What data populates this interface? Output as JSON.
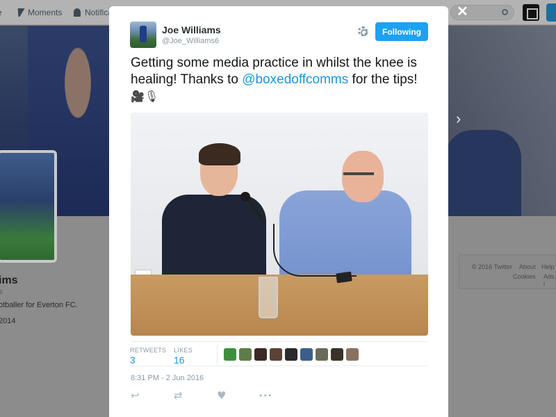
{
  "background": {
    "nav": {
      "home_label": "e",
      "moments_label": "Moments",
      "notifications_label": "Notificat"
    },
    "profile": {
      "name_fragment": "ims",
      "handle_fragment": "s",
      "bio_fragment": "otballer for Everton FC.",
      "joined_fragment": "2014"
    },
    "footer": {
      "copyright": "© 2016 Twitter",
      "about": "About",
      "help": "Help",
      "cookies": "Cookies",
      "ads": "Ads i"
    }
  },
  "modal": {
    "close_icon": "close-icon",
    "author": {
      "name": "Joe Williams",
      "handle": "@Joe_Williams6"
    },
    "follow_button_label": "Following",
    "tweet": {
      "text_before": "Getting some media practice in whilst the knee is healing! Thanks to ",
      "mention": "@boxedoffcomms",
      "text_after": " for the tips! ",
      "emoji": "🎥🎙"
    },
    "stats": {
      "retweets_label": "RETWEETS",
      "retweets_value": "3",
      "likes_label": "LIKES",
      "likes_value": "16"
    },
    "liker_colors": [
      "#3d8f3d",
      "#5c7d48",
      "#3c2a26",
      "#5a4234",
      "#2c2a2a",
      "#3b5f8a",
      "#6a6a5a",
      "#3a3128",
      "#8a7260"
    ],
    "timestamp": "8:31 PM - 2 Jun 2016",
    "actions": {
      "reply_icon": "↩",
      "retweet_icon": "⇄",
      "like_icon": "♥",
      "more_icon": "•••"
    }
  },
  "colors": {
    "accent": "#1da1f2",
    "link": "#1b95e0",
    "muted": "#8899a6"
  }
}
